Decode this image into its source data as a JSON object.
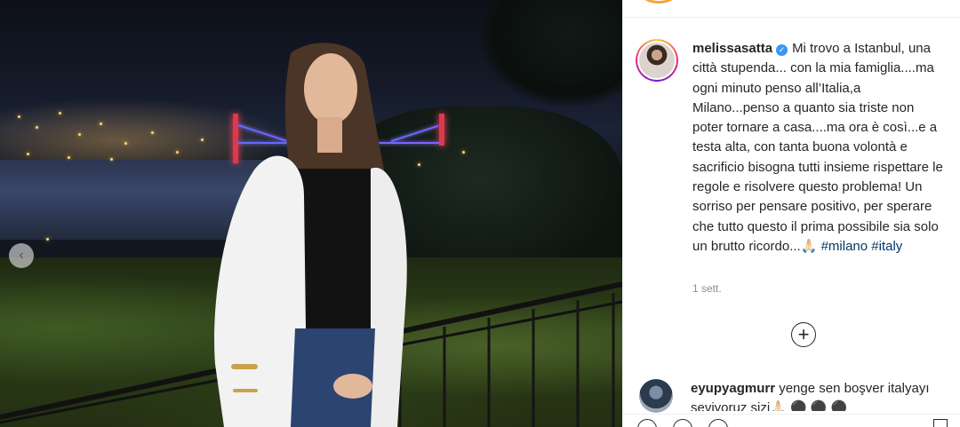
{
  "post": {
    "image_alt": "",
    "carousel_prev": "‹"
  },
  "caption": {
    "username": "melissasatta",
    "verified_glyph": "✓",
    "text": "Mi trovo a Istanbul, una città stupenda... con la mia famiglia....ma ogni minuto penso all’Italia,a Milano...penso a quanto sia triste non poter tornare a casa....ma ora è così...e a testa alta, con tanta buona volontà e sacrificio bisogna tutti insieme rispettare le regole e risolvere questo problema! Un sorriso per pensare positivo, per sperare che tutto questo il prima possibile sia solo un brutto ricordo...🙏🏻",
    "hashtags": [
      "#milano",
      "#italy"
    ],
    "timestamp": "1 sett."
  },
  "load_more": {
    "glyph": "+"
  },
  "comments": [
    {
      "username": "eyupyagmurr",
      "text": "yenge sen boşver italyayı seviyoruz sizi🙏🏻 ⚫ ⚫ ⚫"
    }
  ],
  "colors": {
    "verified": "#3897f0",
    "hashtag": "#00376b",
    "timestamp": "#8e8e8e",
    "story_ring": "#ee2a7b"
  }
}
